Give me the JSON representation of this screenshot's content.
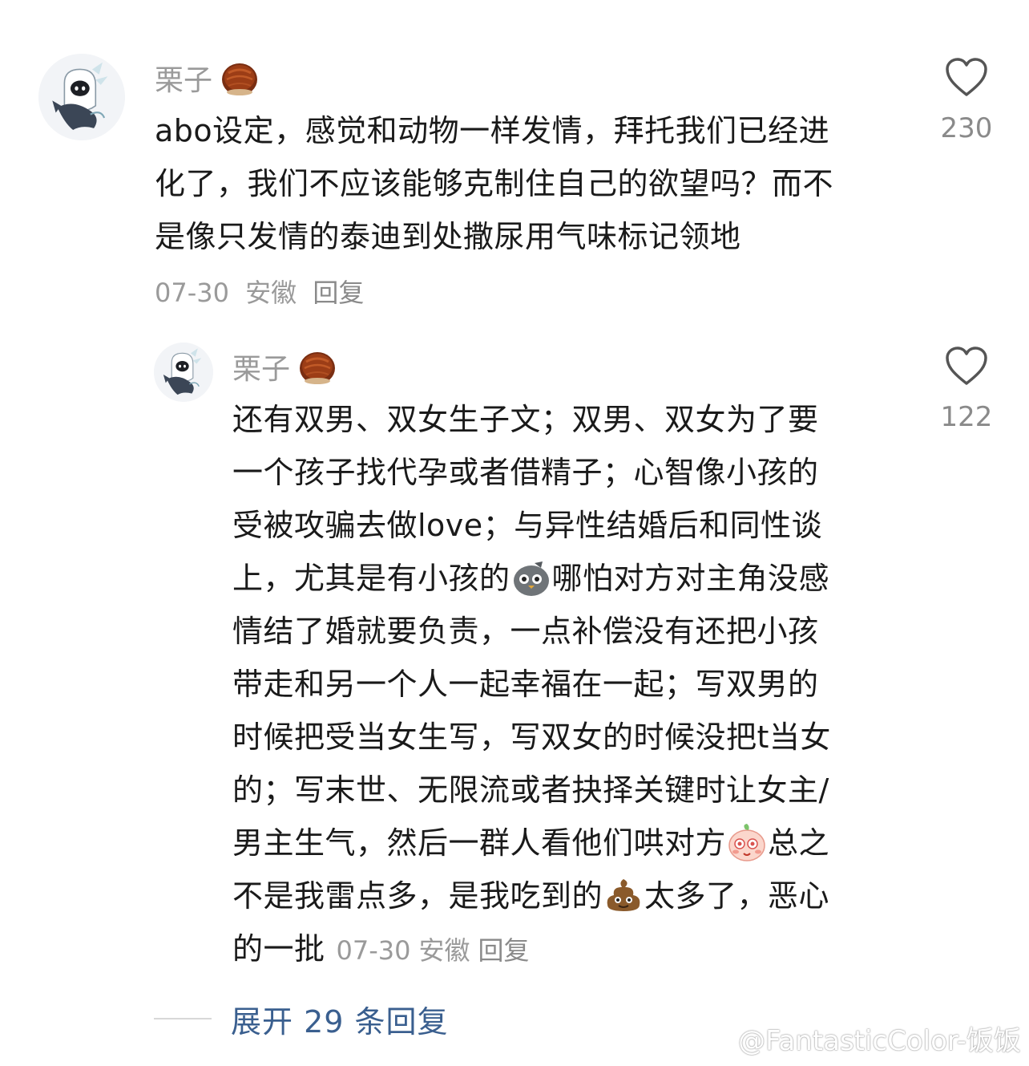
{
  "comment1": {
    "avatar_icon": "ghost-fish-avatar",
    "username": "栗子",
    "username_badge_icon": "chestnut-icon",
    "body_lines": [
      "abo设定，感觉和动物一样发情，拜托我们已经进",
      "化了，我们不应该能够克制住自己的欲望吗？而不",
      "是像只发情的泰迪到处撒尿用气味标记领地"
    ],
    "date": "07-30",
    "location": "安徽",
    "reply_label": "回复",
    "like_icon": "heart-outline-icon",
    "like_count": "230"
  },
  "comment2": {
    "avatar_icon": "ghost-fish-avatar",
    "username": "栗子",
    "username_badge_icon": "chestnut-icon",
    "lines": {
      "l1": "还有双男、双女生子文；双男、双女为了要",
      "l2": "一个孩子找代孕或者借精子；心智像小孩的",
      "l3": "受被攻骗去做love；与异性结婚后和同性谈",
      "l4a": "上，尤其是有小孩的",
      "l4b": "哪怕对方对主角没感",
      "l5": "情结了婚就要负责，一点补偿没有还把小孩",
      "l6": "带走和另一个人一起幸福在一起；写双男的",
      "l7": "时候把受当女生写，写双女的时候没把t当女",
      "l8": "的；写末世、无限流或者抉择关键时让女主/",
      "l9a": "男主生气，然后一群人看他们哄对方",
      "l9b": "总之",
      "l10a": "不是我雷点多，是我吃到的",
      "l10b": "太多了，恶心",
      "l11": "的一批"
    },
    "emoji_1": "grey-pigeon-emoji",
    "emoji_2": "peach-blush-emoji",
    "emoji_3": "poop-emoji",
    "date": "07-30",
    "location": "安徽",
    "reply_label": "回复",
    "like_icon": "heart-outline-icon",
    "like_count": "122"
  },
  "expand_replies": "展开 29 条回复",
  "watermark": {
    "icon": "weibo-icon",
    "text": "@FantasticColor-饭饭"
  },
  "colors": {
    "text": "#1a1a1a",
    "muted": "#9a9a9a",
    "link": "#3a5f8f"
  }
}
